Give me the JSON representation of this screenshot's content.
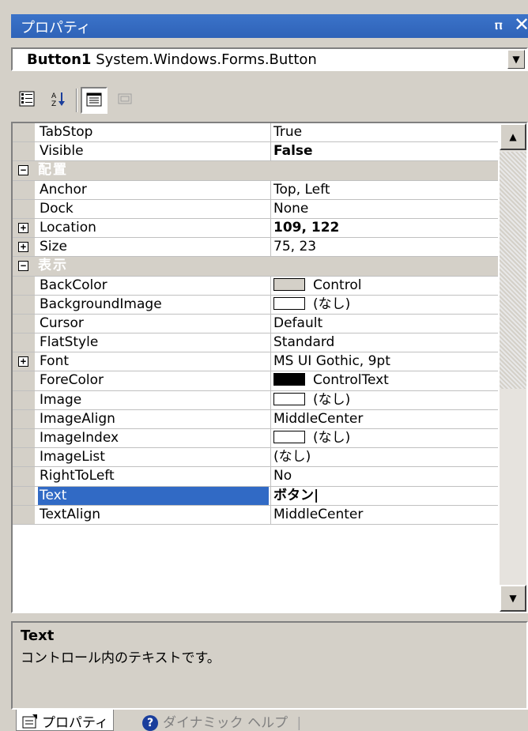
{
  "window": {
    "title": "プロパティ",
    "pin_glyph": "ⲡ",
    "close_glyph": "✕"
  },
  "object_selector": {
    "name": "Button1",
    "type": "System.Windows.Forms.Button"
  },
  "toolbar": {
    "buttons": [
      {
        "name": "categorized-button",
        "icon": "categorized-icon",
        "pressed": false
      },
      {
        "name": "alphabetical-button",
        "icon": "alphabetical-icon",
        "pressed": false
      },
      {
        "name": "properties-button",
        "icon": "properties-icon",
        "pressed": true
      },
      {
        "name": "events-button",
        "icon": "events-icon",
        "pressed": false
      }
    ]
  },
  "grid": {
    "rows": [
      {
        "type": "prop",
        "name": "TabStop",
        "value": "True"
      },
      {
        "type": "prop",
        "name": "Visible",
        "value": "False",
        "bold": true
      },
      {
        "type": "cat",
        "name": "配置",
        "expander": "−"
      },
      {
        "type": "prop",
        "name": "Anchor",
        "value": "Top, Left"
      },
      {
        "type": "prop",
        "name": "Dock",
        "value": "None"
      },
      {
        "type": "prop",
        "name": "Location",
        "value": "109, 122",
        "bold": true,
        "expander": "+"
      },
      {
        "type": "prop",
        "name": "Size",
        "value": "75, 23",
        "expander": "+"
      },
      {
        "type": "cat",
        "name": "表示",
        "expander": "−"
      },
      {
        "type": "prop",
        "name": "BackColor",
        "value": "Control",
        "swatch": "#d4d0c8"
      },
      {
        "type": "prop",
        "name": "BackgroundImage",
        "value": "(なし)",
        "swatch": "#ffffff"
      },
      {
        "type": "prop",
        "name": "Cursor",
        "value": "Default"
      },
      {
        "type": "prop",
        "name": "FlatStyle",
        "value": "Standard"
      },
      {
        "type": "prop",
        "name": "Font",
        "value": "MS UI Gothic, 9pt",
        "expander": "+"
      },
      {
        "type": "prop",
        "name": "ForeColor",
        "value": "ControlText",
        "swatch": "#000000"
      },
      {
        "type": "prop",
        "name": "Image",
        "value": "(なし)",
        "swatch": "#ffffff"
      },
      {
        "type": "prop",
        "name": "ImageAlign",
        "value": "MiddleCenter"
      },
      {
        "type": "prop",
        "name": "ImageIndex",
        "value": "(なし)",
        "swatch": "#ffffff"
      },
      {
        "type": "prop",
        "name": "ImageList",
        "value": "(なし)"
      },
      {
        "type": "prop",
        "name": "RightToLeft",
        "value": "No"
      },
      {
        "type": "prop",
        "name": "Text",
        "value": "ボタン|",
        "bold": true,
        "selected": true
      },
      {
        "type": "prop",
        "name": "TextAlign",
        "value": "MiddleCenter"
      }
    ]
  },
  "help": {
    "title": "Text",
    "description": "コントロール内のテキストです。"
  },
  "tabs": [
    {
      "label": "プロパティ",
      "icon": "properties-tab-icon",
      "active": true
    },
    {
      "label": "ダイナミック ヘルプ",
      "icon": "help-icon",
      "active": false
    }
  ],
  "colors": {
    "accent": "#316ac5",
    "title_bar": "#2f63b8",
    "face": "#d4d0c8"
  }
}
